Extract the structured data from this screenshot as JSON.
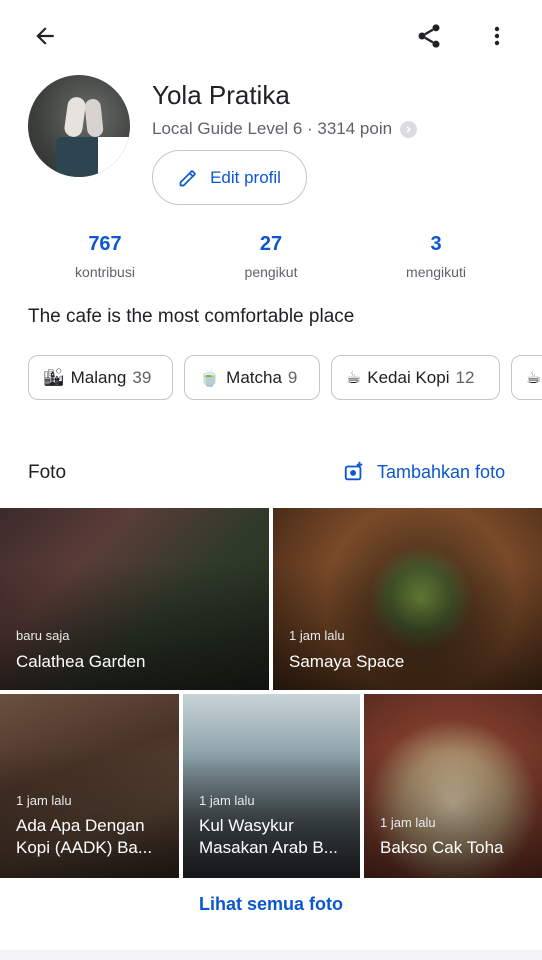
{
  "topbar": {
    "back_icon": "arrow-back-icon",
    "share_icon": "share-icon",
    "more_icon": "more-vert-icon"
  },
  "profile": {
    "name": "Yola Pratika",
    "level": "Local Guide Level 6 · 3314 poin",
    "edit_label": "Edit profil"
  },
  "stats": [
    {
      "value": "767",
      "label": "kontribusi"
    },
    {
      "value": "27",
      "label": "pengikut"
    },
    {
      "value": "3",
      "label": "mengikuti"
    }
  ],
  "bio": "The cafe is the most comfortable place",
  "chips": [
    {
      "emoji": "🏙",
      "label": "Malang",
      "count": "39"
    },
    {
      "emoji": "🍵",
      "label": "Matcha",
      "count": "9"
    },
    {
      "emoji": "☕",
      "label": "Kedai Kopi",
      "count": "12"
    },
    {
      "emoji": "☕",
      "label": "",
      "count": ""
    }
  ],
  "photos_section": {
    "title": "Foto",
    "add_label": "Tambahkan foto",
    "items": [
      {
        "time": "baru saja",
        "name": "Calathea Garden"
      },
      {
        "time": "1 jam lalu",
        "name": "Samaya Space"
      },
      {
        "time": "1 jam lalu",
        "name_line1": "Ada Apa Dengan",
        "name_line2": "Kopi (AADK) Ba..."
      },
      {
        "time": "1 jam lalu",
        "name_line1": "Kul Wasykur",
        "name_line2": "Masakan Arab B..."
      },
      {
        "time": "1 jam lalu",
        "name": "Bakso Cak Toha"
      }
    ],
    "see_all": "Lihat semua foto"
  },
  "colors": {
    "accent": "#0b57d0",
    "text": "#202124",
    "muted": "#5f6368",
    "outline": "#c4c7c5"
  }
}
